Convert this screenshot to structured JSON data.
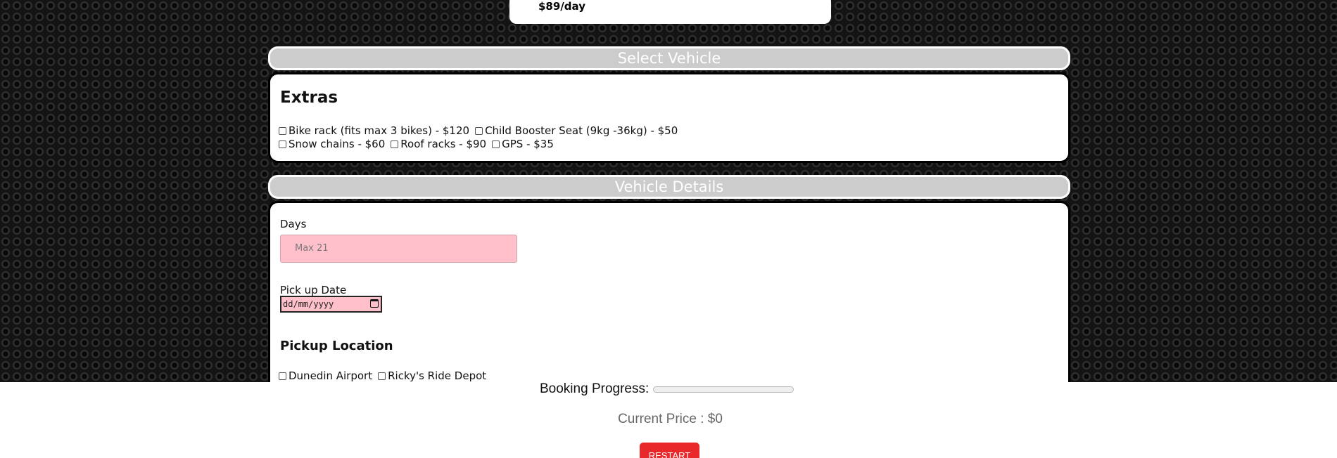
{
  "previous_vehicle": {
    "price": "$89/day"
  },
  "select_vehicle_header": "Select Vehicle",
  "extras": {
    "title": "Extras",
    "options": [
      {
        "label": "Bike rack (fits max 3 bikes) - $120",
        "checked": false
      },
      {
        "label": "Child Booster Seat (9kg -36kg) - $50",
        "checked": false
      },
      {
        "label": "Snow chains - $60",
        "checked": false
      },
      {
        "label": "Roof racks - $90",
        "checked": false
      },
      {
        "label": "GPS - $35",
        "checked": false
      }
    ]
  },
  "vehicle_details_header": "Vehicle Details",
  "vehicle_details": {
    "days_label": "Days",
    "days_placeholder": "Max 21",
    "pickup_date_label": "Pick up Date",
    "pickup_date_placeholder": "dd/mm/yyyy",
    "pickup_location_title": "Pickup Location",
    "locations": [
      {
        "label": "Dunedin Airport",
        "checked": false
      },
      {
        "label": "Ricky's Ride Depot",
        "checked": false
      }
    ]
  },
  "footer": {
    "progress_label": "Booking Progress:",
    "progress_value": 0,
    "current_price": "Current Price : $0",
    "restart_label": "RESTART"
  },
  "colors": {
    "header_bg": "#cccccc",
    "input_invalid_bg": "#ffc0cb",
    "restart_bg": "#e8282b"
  }
}
